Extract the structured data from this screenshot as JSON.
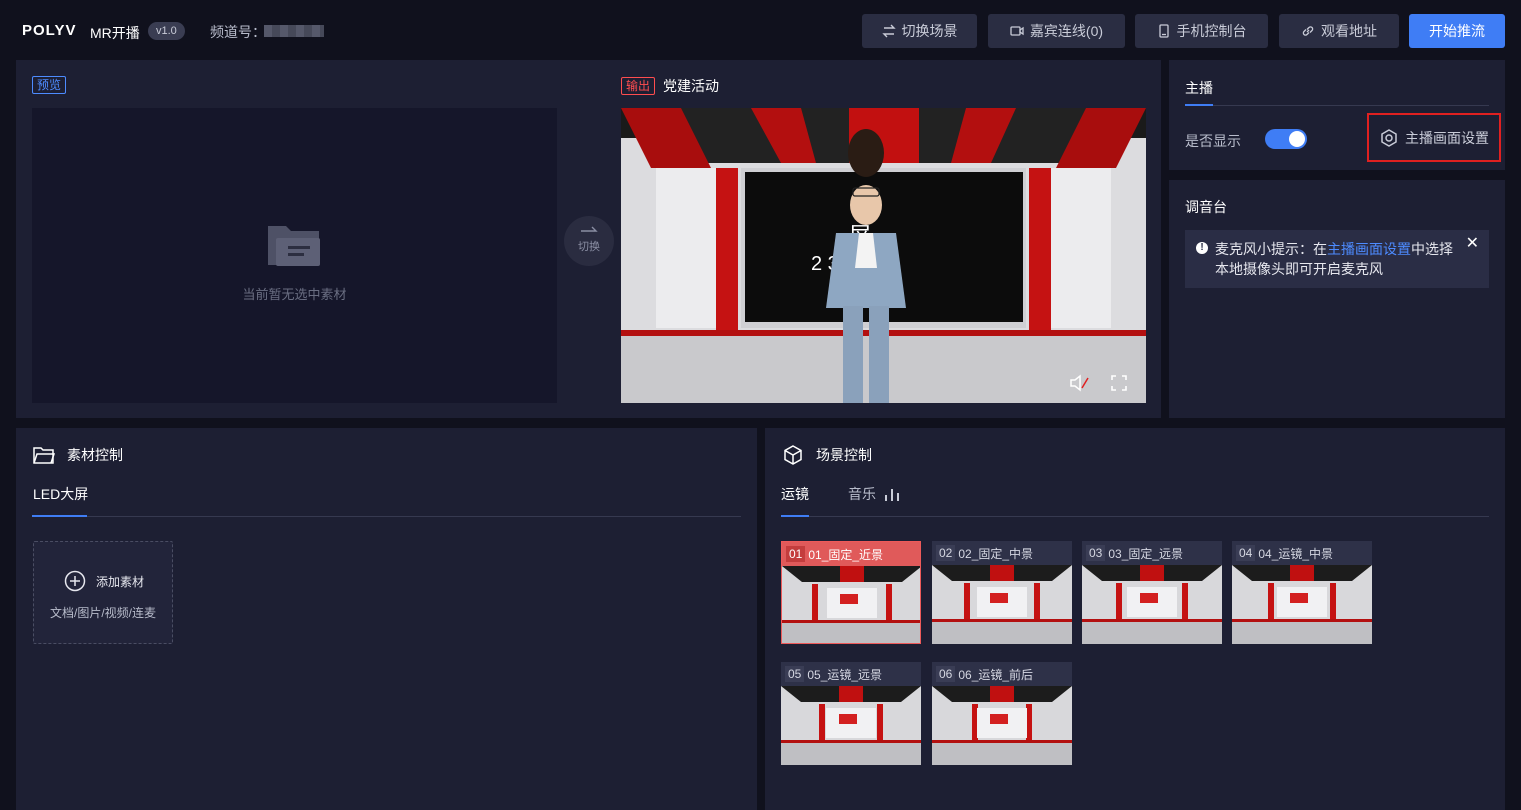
{
  "header": {
    "logo": "POLYV",
    "app_name": "MR开播",
    "version": "v1.0",
    "channel_label": "频道号：",
    "buttons": {
      "switch_scene": "切换场景",
      "guest_link": "嘉宾连线(0)",
      "mobile_console": "手机控制台",
      "watch_url": "观看地址",
      "start_stream": "开始推流"
    }
  },
  "preview": {
    "tag": "预览",
    "empty_text": "当前暂无选中素材",
    "switch_label": "切换"
  },
  "output": {
    "tag": "输出",
    "title": "党建活动"
  },
  "anchor": {
    "tab": "主播",
    "show_label": "是否显示",
    "show_enabled": true,
    "settings_label": "主播画面设置"
  },
  "mixer": {
    "title": "调音台",
    "tip_prefix": "麦克风小提示：在",
    "tip_link": "主播画面设置",
    "tip_suffix": "中选择",
    "tip_line2": "本地摄像头即可开启麦克风"
  },
  "material": {
    "title": "素材控制",
    "tab": "LED大屏",
    "add_label": "添加素材",
    "add_hint": "文档/图片/视频/连麦"
  },
  "scene_control": {
    "title": "场景控制",
    "tabs": [
      "运镜",
      "音乐"
    ],
    "scenes": [
      {
        "num": "01",
        "name": "01_固定_近景",
        "active": true
      },
      {
        "num": "02",
        "name": "02_固定_中景",
        "active": false
      },
      {
        "num": "03",
        "name": "03_固定_远景",
        "active": false
      },
      {
        "num": "04",
        "name": "04_运镜_中景",
        "active": false
      },
      {
        "num": "05",
        "name": "05_运镜_远景",
        "active": false
      },
      {
        "num": "06",
        "name": "06_运镜_前后",
        "active": false
      }
    ]
  },
  "colors": {
    "accent": "#3f7df5",
    "danger": "#e02020",
    "panel": "#1d1f33",
    "background": "#10111d"
  }
}
